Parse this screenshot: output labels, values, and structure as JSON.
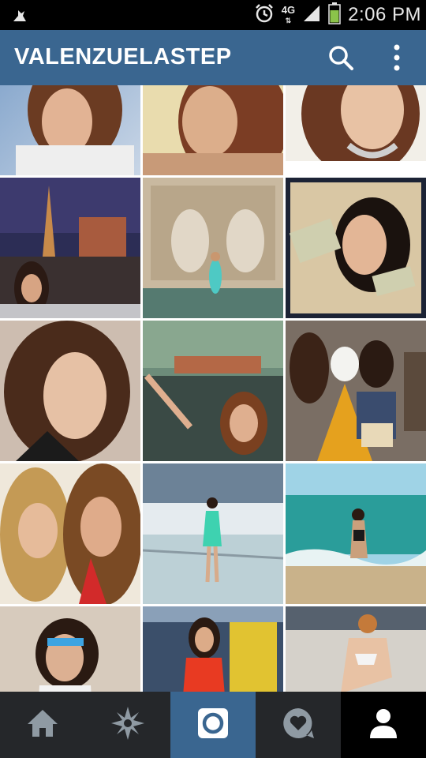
{
  "status_bar": {
    "time": "2:06 PM",
    "network": "4G",
    "icons": [
      "usb-debug-icon",
      "alarm-icon",
      "4g-icon",
      "signal-icon",
      "battery-icon"
    ]
  },
  "app_bar": {
    "title": "VALENZUELASTEP",
    "actions": [
      "search-icon",
      "overflow-menu-icon"
    ],
    "background": "#3a6690"
  },
  "photo_grid": {
    "columns": 3,
    "photos": [
      {
        "id": "photo-1",
        "scene": "close-up selfie, brown hair"
      },
      {
        "id": "photo-2",
        "scene": "portrait, sepia tone"
      },
      {
        "id": "photo-3",
        "scene": "selfie with necklace"
      },
      {
        "id": "photo-4",
        "scene": "Las Vegas night, Eiffel tower"
      },
      {
        "id": "photo-5",
        "scene": "fountain statues"
      },
      {
        "id": "photo-6",
        "scene": "kissing money, polaroid frame"
      },
      {
        "id": "photo-7",
        "scene": "smiling selfie"
      },
      {
        "id": "photo-8",
        "scene": "river boats"
      },
      {
        "id": "photo-9",
        "scene": "day of the dead parade"
      },
      {
        "id": "photo-10",
        "scene": "two friends selfie"
      },
      {
        "id": "photo-11",
        "scene": "yacht deck, green dress"
      },
      {
        "id": "photo-12",
        "scene": "beach, turquoise sea"
      },
      {
        "id": "photo-13",
        "scene": "sunglasses selfie"
      },
      {
        "id": "photo-14",
        "scene": "red dress, yellow truck"
      },
      {
        "id": "photo-15",
        "scene": "pool deck, bikini"
      }
    ]
  },
  "tab_bar": {
    "tabs": [
      {
        "name": "tab-home",
        "icon": "home-icon"
      },
      {
        "name": "tab-explore",
        "icon": "explore-star-icon"
      },
      {
        "name": "tab-camera",
        "icon": "camera-icon",
        "highlight": "#3a6690"
      },
      {
        "name": "tab-activity",
        "icon": "heart-bubble-icon"
      },
      {
        "name": "tab-profile",
        "icon": "profile-icon",
        "selected": true
      }
    ]
  }
}
